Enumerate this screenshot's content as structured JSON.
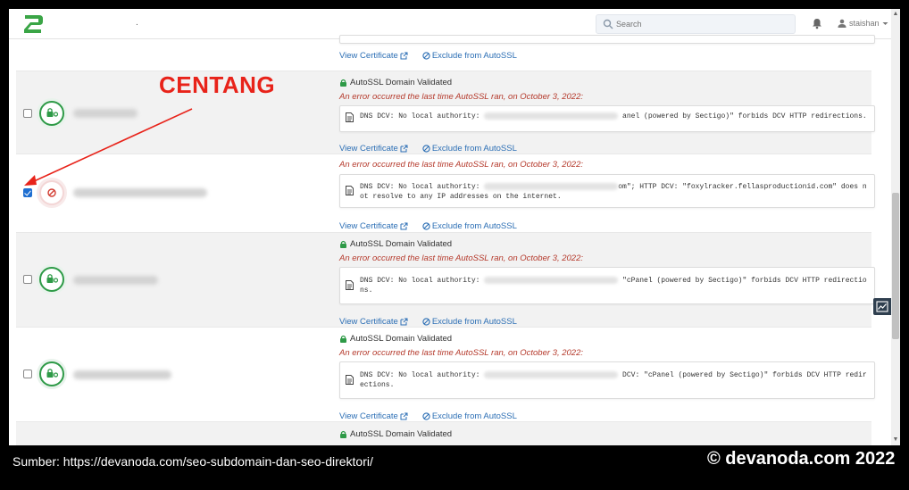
{
  "topbar": {
    "dot": ".",
    "search_placeholder": "Search",
    "username": "staishan"
  },
  "annotation": {
    "label": "CENTANG"
  },
  "rows": {
    "r0": {
      "view": "View Certificate",
      "exclude": "Exclude from AutoSSL"
    },
    "r1": {
      "validated": "AutoSSL Domain Validated",
      "error": "An error occurred the last time AutoSSL ran, on October 3, 2022:",
      "code_a": "DNS DCV: No local authority:",
      "code_b": "anel (powered by Sectigo)\" forbids DCV HTTP redirections.",
      "view": "View Certificate",
      "exclude": "Exclude from AutoSSL"
    },
    "r2": {
      "error": "An error occurred the last time AutoSSL ran, on October 3, 2022:",
      "code_a": "DNS DCV: No local authority:",
      "code_b": "om\"; HTTP DCV: \"foxylracker.fellasproductionid.com\" does not resolve to any IP addresses on the internet.",
      "view": "View Certificate",
      "exclude": "Exclude from AutoSSL"
    },
    "r3": {
      "validated": "AutoSSL Domain Validated",
      "error": "An error occurred the last time AutoSSL ran, on October 3, 2022:",
      "code_a": "DNS DCV: No local authority:",
      "code_b": "\"cPanel (powered by Sectigo)\" forbids DCV HTTP redirections.",
      "view": "View Certificate",
      "exclude": "Exclude from AutoSSL"
    },
    "r4": {
      "validated": "AutoSSL Domain Validated",
      "error": "An error occurred the last time AutoSSL ran, on October 3, 2022:",
      "code_a": "DNS DCV: No local authority:",
      "code_b": "DCV: \"cPanel (powered by Sectigo)\" forbids DCV HTTP redirections.",
      "view": "View Certificate",
      "exclude": "Exclude from AutoSSL"
    },
    "r5": {
      "validated": "AutoSSL Domain Validated"
    }
  },
  "footer": {
    "source": "Sumber:  https://devanoda.com/seo-subdomain-dan-seo-direktori/",
    "copyright": "© devanoda.com 2022"
  },
  "colors": {
    "accent": "#e8231a",
    "link": "#2c6fb5",
    "error": "#b53a2c",
    "ok": "#2e9a47"
  }
}
